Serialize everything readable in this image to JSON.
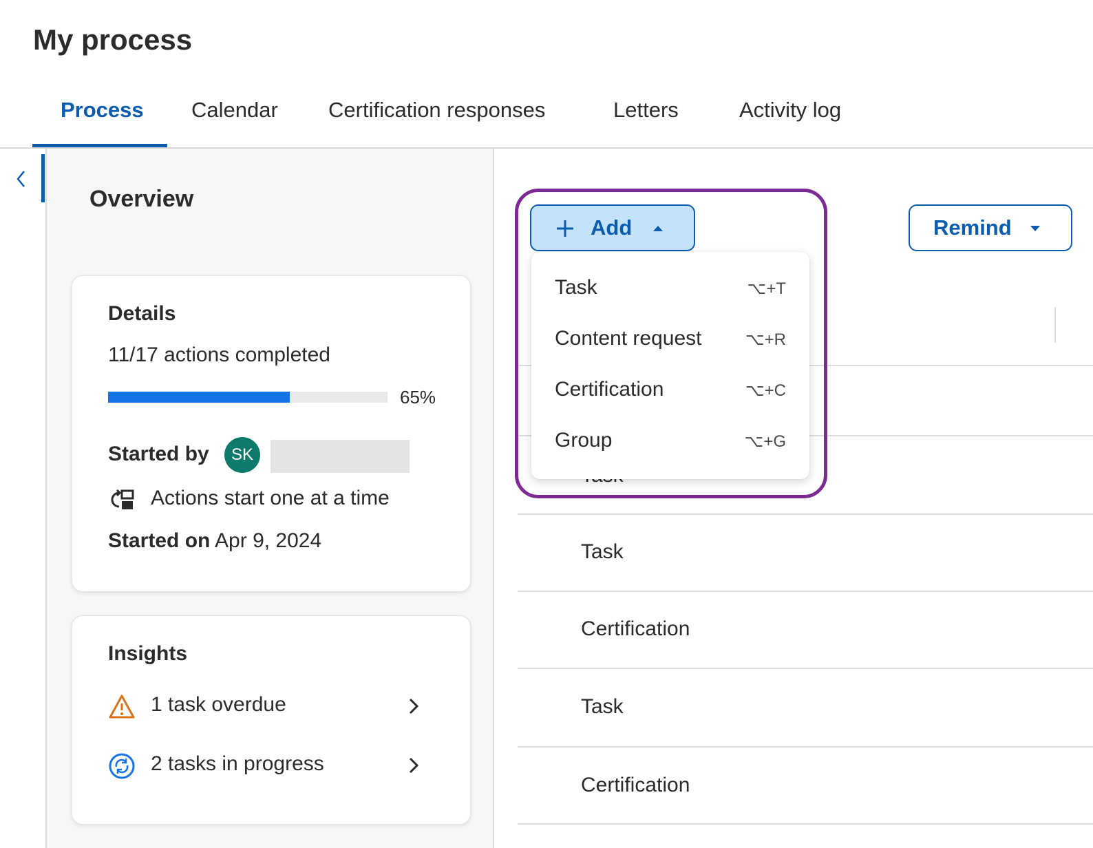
{
  "page": {
    "title": "My process"
  },
  "tabs": [
    {
      "label": "Process",
      "active": true
    },
    {
      "label": "Calendar",
      "active": false
    },
    {
      "label": "Certification responses",
      "active": false
    },
    {
      "label": "Letters",
      "active": false
    },
    {
      "label": "Activity log",
      "active": false
    }
  ],
  "overview": {
    "title": "Overview",
    "details": {
      "title": "Details",
      "actions_completed": "11/17 actions completed",
      "progress": {
        "fraction": 0.65,
        "label": "65%"
      },
      "started_by_label": "Started by",
      "avatar_initials": "SK",
      "mode_text": "Actions start one at a time",
      "started_on_label": "Started on",
      "started_on_date": "Apr 9, 2024"
    },
    "insights": {
      "title": "Insights",
      "items": [
        {
          "text": "1 task overdue",
          "icon": "warning-icon"
        },
        {
          "text": "2 tasks in progress",
          "icon": "in-progress-icon"
        }
      ]
    }
  },
  "toolbar": {
    "add_label": "Add",
    "remind_label": "Remind"
  },
  "add_menu": {
    "items": [
      {
        "label": "Task",
        "shortcut": "⌥+T"
      },
      {
        "label": "Content request",
        "shortcut": "⌥+R"
      },
      {
        "label": "Certification",
        "shortcut": "⌥+C"
      },
      {
        "label": "Group",
        "shortcut": "⌥+G"
      }
    ]
  },
  "actions_list": {
    "partially_hidden_row": "Task",
    "rows": [
      {
        "label": "Task"
      },
      {
        "label": "Certification"
      },
      {
        "label": "Task"
      },
      {
        "label": "Certification"
      }
    ]
  },
  "colors": {
    "accent": "#0b5cad",
    "add_button_bg": "#c5e2fb",
    "progress": "#1473e6",
    "avatar": "#0e7a6c",
    "highlight": "#7d2a95",
    "warning": "#d9731a"
  }
}
